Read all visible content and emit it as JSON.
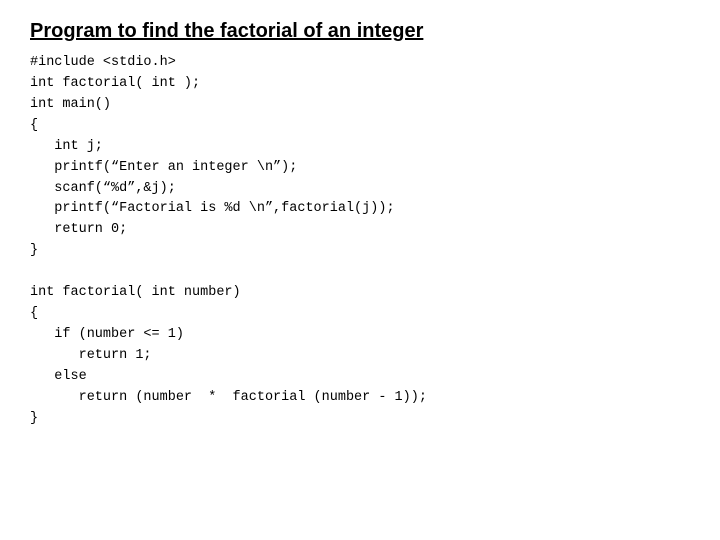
{
  "title": "Program to find the factorial of an integer",
  "code": "#include <stdio.h>\nint factorial( int );\nint main()\n{\n   int j;\n   printf(\"“Enter an integer \\n\");\n   scanf(\"%d\",&j);\n   printf(\"“Factorial is %d \\n\",factorial(j));\n   return 0;\n}\n\nint factorial( int number)\n{\n   if (number <= 1)\n      return 1;\n   else\n      return (number  *  factorial (number - 1));\n}"
}
